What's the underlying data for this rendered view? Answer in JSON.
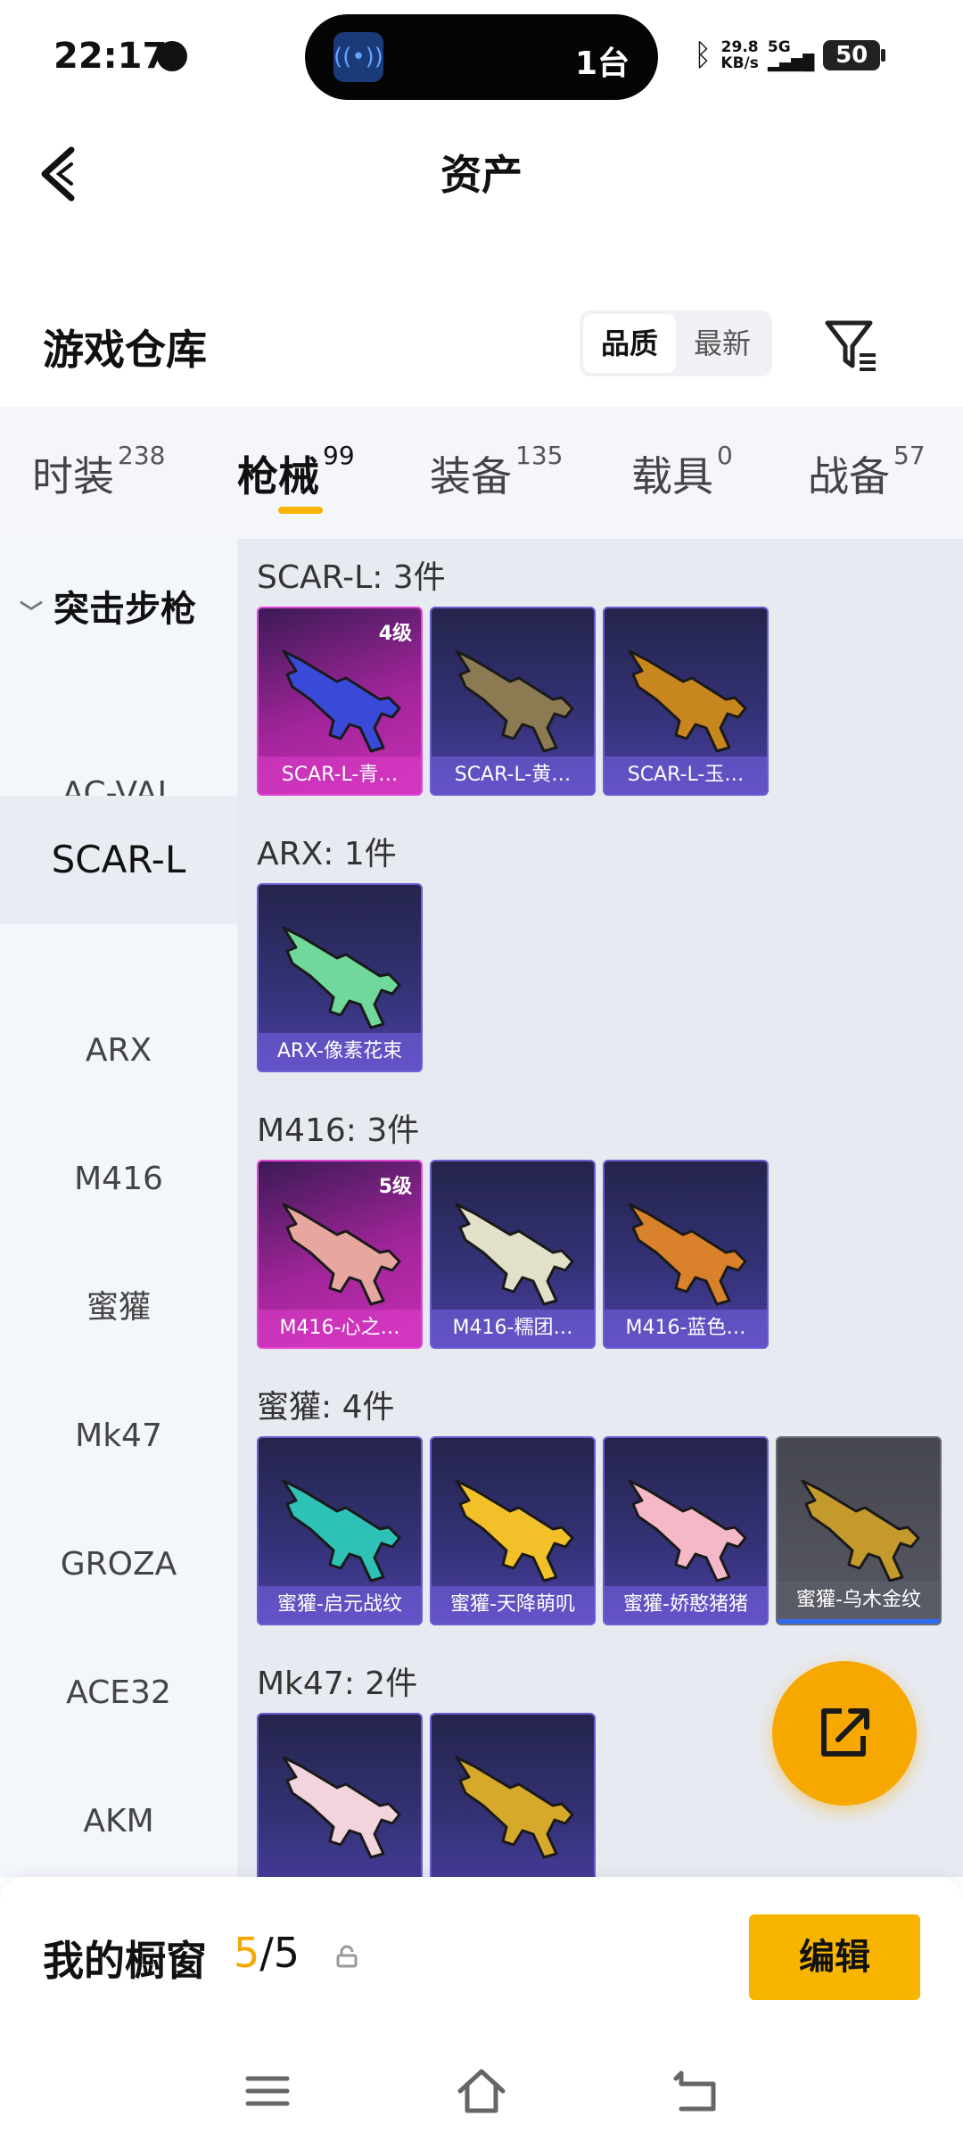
{
  "status_bar": {
    "time": "22:17",
    "island_text": "1台",
    "net_speed_value": "29.8",
    "net_speed_unit": "KB/s",
    "network": "5G",
    "battery": "50"
  },
  "header": {
    "title": "资产"
  },
  "warehouse": {
    "title": "游戏仓库",
    "sort_options": [
      "品质",
      "最新"
    ],
    "sort_selected": "品质"
  },
  "tabs": [
    {
      "label": "时装",
      "count": "238"
    },
    {
      "label": "枪械",
      "count": "99"
    },
    {
      "label": "装备",
      "count": "135"
    },
    {
      "label": "载具",
      "count": "0"
    },
    {
      "label": "战备",
      "count": "57"
    }
  ],
  "active_tab": "枪械",
  "sidebar": {
    "category": "突击步枪",
    "items": [
      "AC-VAL",
      "SCAR-L",
      "ARX",
      "M416",
      "蜜獾",
      "Mk47",
      "GROZA",
      "ACE32",
      "AKM"
    ],
    "selected": "SCAR-L"
  },
  "sections": [
    {
      "label": "SCAR-L: 3件",
      "items": [
        {
          "name": "SCAR-L-青…",
          "level": "4级",
          "rarity": "legend",
          "gun_color": "#3a4ad8"
        },
        {
          "name": "SCAR-L-黄…",
          "level": "",
          "rarity": "epic",
          "gun_color": "#8b7a52"
        },
        {
          "name": "SCAR-L-玉…",
          "level": "",
          "rarity": "epic",
          "gun_color": "#c8861e"
        }
      ]
    },
    {
      "label": "ARX: 1件",
      "items": [
        {
          "name": "ARX-像素花束",
          "level": "",
          "rarity": "epic",
          "gun_color": "#6fd89a"
        }
      ]
    },
    {
      "label": "M416: 3件",
      "items": [
        {
          "name": "M416-心之…",
          "level": "5级",
          "rarity": "legend",
          "gun_color": "#e7a6a0"
        },
        {
          "name": "M416-糯团…",
          "level": "",
          "rarity": "epic",
          "gun_color": "#e2e0c8"
        },
        {
          "name": "M416-蓝色…",
          "level": "",
          "rarity": "epic",
          "gun_color": "#d9822b"
        }
      ]
    },
    {
      "label": "蜜獾: 4件",
      "items": [
        {
          "name": "蜜獾-启元战纹",
          "level": "",
          "rarity": "epic",
          "gun_color": "#2ec1b5"
        },
        {
          "name": "蜜獾-天降萌叽",
          "level": "",
          "rarity": "epic",
          "gun_color": "#f2c12a"
        },
        {
          "name": "蜜獾-娇憨猪猪",
          "level": "",
          "rarity": "epic",
          "gun_color": "#f5b8c8"
        },
        {
          "name": "蜜獾-乌木金纹",
          "level": "",
          "rarity": "grey",
          "gun_color": "#c59a2d"
        }
      ]
    },
    {
      "label": "Mk47: 2件",
      "items": [
        {
          "name": "",
          "level": "",
          "rarity": "epic",
          "gun_color": "#f3d4dc"
        },
        {
          "name": "",
          "level": "",
          "rarity": "epic",
          "gun_color": "#d6a92a"
        }
      ]
    }
  ],
  "showcase": {
    "label": "我的橱窗",
    "current": "5",
    "separator": "/",
    "total": "5",
    "edit_label": "编辑"
  },
  "colors": {
    "accent": "#f7b500",
    "legend": "#c62fb4",
    "epic": "#4b3ea4"
  }
}
